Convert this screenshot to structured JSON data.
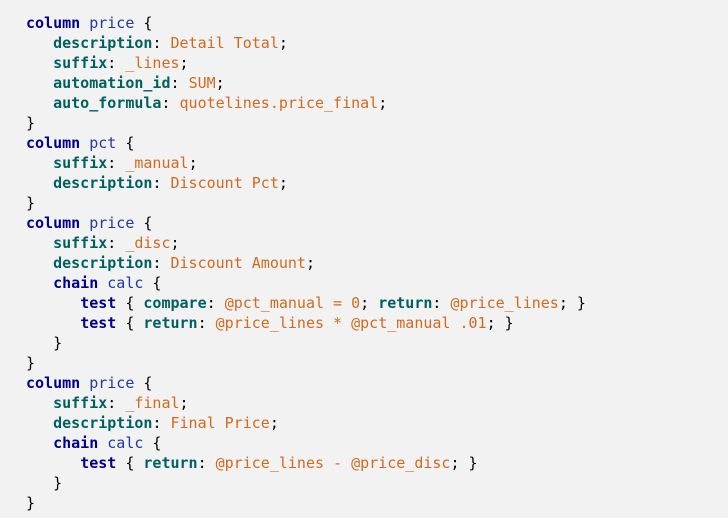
{
  "colors": {
    "background": "#f2f2f2",
    "keyword": "#00008b",
    "identifier": "#1e3aa8",
    "property": "#006060",
    "value": "#d2691e",
    "punctuation": "#000000"
  },
  "code_lines": [
    [
      {
        "t": "kw",
        "s": "column"
      },
      {
        "t": "punc",
        "s": " "
      },
      {
        "t": "ident",
        "s": "price"
      },
      {
        "t": "punc",
        "s": " {"
      }
    ],
    [
      {
        "t": "punc",
        "s": "   "
      },
      {
        "t": "prop",
        "s": "description"
      },
      {
        "t": "punc",
        "s": ": "
      },
      {
        "t": "val",
        "s": "Detail Total"
      },
      {
        "t": "punc",
        "s": ";"
      }
    ],
    [
      {
        "t": "punc",
        "s": "   "
      },
      {
        "t": "prop",
        "s": "suffix"
      },
      {
        "t": "punc",
        "s": ": "
      },
      {
        "t": "val",
        "s": "_lines"
      },
      {
        "t": "punc",
        "s": ";"
      }
    ],
    [
      {
        "t": "punc",
        "s": "   "
      },
      {
        "t": "prop",
        "s": "automation_id"
      },
      {
        "t": "punc",
        "s": ": "
      },
      {
        "t": "val",
        "s": "SUM"
      },
      {
        "t": "punc",
        "s": ";"
      }
    ],
    [
      {
        "t": "punc",
        "s": "   "
      },
      {
        "t": "prop",
        "s": "auto_formula"
      },
      {
        "t": "punc",
        "s": ": "
      },
      {
        "t": "val",
        "s": "quotelines.price_final"
      },
      {
        "t": "punc",
        "s": ";"
      }
    ],
    [
      {
        "t": "punc",
        "s": "}"
      }
    ],
    [
      {
        "t": "kw",
        "s": "column"
      },
      {
        "t": "punc",
        "s": " "
      },
      {
        "t": "ident",
        "s": "pct"
      },
      {
        "t": "punc",
        "s": " {"
      }
    ],
    [
      {
        "t": "punc",
        "s": "   "
      },
      {
        "t": "prop",
        "s": "suffix"
      },
      {
        "t": "punc",
        "s": ": "
      },
      {
        "t": "val",
        "s": "_manual"
      },
      {
        "t": "punc",
        "s": ";"
      }
    ],
    [
      {
        "t": "punc",
        "s": "   "
      },
      {
        "t": "prop",
        "s": "description"
      },
      {
        "t": "punc",
        "s": ": "
      },
      {
        "t": "val",
        "s": "Discount Pct"
      },
      {
        "t": "punc",
        "s": ";"
      }
    ],
    [
      {
        "t": "punc",
        "s": "}"
      }
    ],
    [
      {
        "t": "kw",
        "s": "column"
      },
      {
        "t": "punc",
        "s": " "
      },
      {
        "t": "ident",
        "s": "price"
      },
      {
        "t": "punc",
        "s": " {"
      }
    ],
    [
      {
        "t": "punc",
        "s": "   "
      },
      {
        "t": "prop",
        "s": "suffix"
      },
      {
        "t": "punc",
        "s": ": "
      },
      {
        "t": "val",
        "s": "_disc"
      },
      {
        "t": "punc",
        "s": ";"
      }
    ],
    [
      {
        "t": "punc",
        "s": "   "
      },
      {
        "t": "prop",
        "s": "description"
      },
      {
        "t": "punc",
        "s": ": "
      },
      {
        "t": "val",
        "s": "Discount Amount"
      },
      {
        "t": "punc",
        "s": ";"
      }
    ],
    [
      {
        "t": "punc",
        "s": "   "
      },
      {
        "t": "kw",
        "s": "chain"
      },
      {
        "t": "punc",
        "s": " "
      },
      {
        "t": "ident",
        "s": "calc"
      },
      {
        "t": "punc",
        "s": " {"
      }
    ],
    [
      {
        "t": "punc",
        "s": "      "
      },
      {
        "t": "kw",
        "s": "test"
      },
      {
        "t": "punc",
        "s": " { "
      },
      {
        "t": "prop",
        "s": "compare"
      },
      {
        "t": "punc",
        "s": ": "
      },
      {
        "t": "val",
        "s": "@pct_manual = 0"
      },
      {
        "t": "punc",
        "s": "; "
      },
      {
        "t": "prop",
        "s": "return"
      },
      {
        "t": "punc",
        "s": ": "
      },
      {
        "t": "val",
        "s": "@price_lines"
      },
      {
        "t": "punc",
        "s": "; }"
      }
    ],
    [
      {
        "t": "punc",
        "s": "      "
      },
      {
        "t": "kw",
        "s": "test"
      },
      {
        "t": "punc",
        "s": " { "
      },
      {
        "t": "prop",
        "s": "return"
      },
      {
        "t": "punc",
        "s": ": "
      },
      {
        "t": "val",
        "s": "@price_lines * @pct_manual .01"
      },
      {
        "t": "punc",
        "s": "; }"
      }
    ],
    [
      {
        "t": "punc",
        "s": "   }"
      }
    ],
    [
      {
        "t": "punc",
        "s": "}"
      }
    ],
    [
      {
        "t": "kw",
        "s": "column"
      },
      {
        "t": "punc",
        "s": " "
      },
      {
        "t": "ident",
        "s": "price"
      },
      {
        "t": "punc",
        "s": " {"
      }
    ],
    [
      {
        "t": "punc",
        "s": "   "
      },
      {
        "t": "prop",
        "s": "suffix"
      },
      {
        "t": "punc",
        "s": ": "
      },
      {
        "t": "val",
        "s": "_final"
      },
      {
        "t": "punc",
        "s": ";"
      }
    ],
    [
      {
        "t": "punc",
        "s": "   "
      },
      {
        "t": "prop",
        "s": "description"
      },
      {
        "t": "punc",
        "s": ": "
      },
      {
        "t": "val",
        "s": "Final Price"
      },
      {
        "t": "punc",
        "s": ";"
      }
    ],
    [
      {
        "t": "punc",
        "s": "   "
      },
      {
        "t": "kw",
        "s": "chain"
      },
      {
        "t": "punc",
        "s": " "
      },
      {
        "t": "ident",
        "s": "calc"
      },
      {
        "t": "punc",
        "s": " {"
      }
    ],
    [
      {
        "t": "punc",
        "s": "      "
      },
      {
        "t": "kw",
        "s": "test"
      },
      {
        "t": "punc",
        "s": " { "
      },
      {
        "t": "prop",
        "s": "return"
      },
      {
        "t": "punc",
        "s": ": "
      },
      {
        "t": "val",
        "s": "@price_lines - @price_disc"
      },
      {
        "t": "punc",
        "s": "; }"
      }
    ],
    [
      {
        "t": "punc",
        "s": "   }"
      }
    ],
    [
      {
        "t": "punc",
        "s": "}"
      }
    ]
  ]
}
